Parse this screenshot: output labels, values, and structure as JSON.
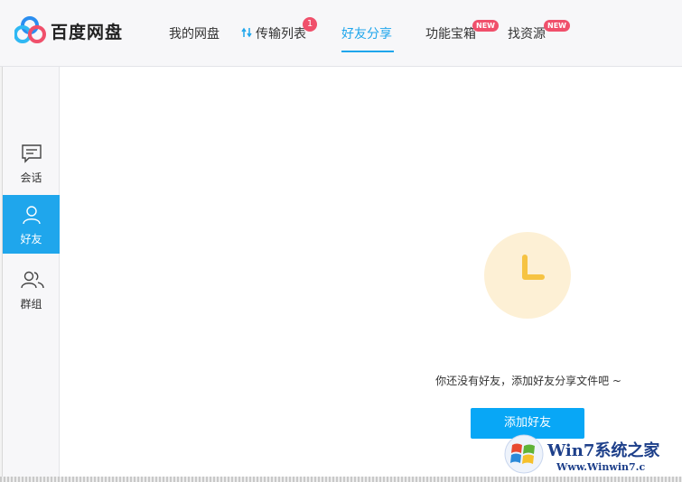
{
  "app": {
    "logo_text": "百度网盘"
  },
  "nav": {
    "items": [
      {
        "label": "我的网盘"
      },
      {
        "label": "传输列表",
        "badge": "1"
      },
      {
        "label": "好友分享",
        "active": true
      },
      {
        "label": "功能宝箱",
        "badge": "NEW"
      },
      {
        "label": "找资源",
        "badge": "NEW"
      }
    ]
  },
  "sidebar": {
    "items": [
      {
        "label": "会话",
        "icon": "chat-icon"
      },
      {
        "label": "好友",
        "icon": "person-icon",
        "active": true
      },
      {
        "label": "群组",
        "icon": "group-icon"
      }
    ]
  },
  "main": {
    "empty_icon": "clock-icon",
    "empty_text": "你还没有好友，添加好友分享文件吧 ~",
    "add_button": "添加好友"
  },
  "watermark": {
    "title": "Win7系统之家",
    "url": "Www.Winwin7.c"
  },
  "colors": {
    "accent": "#1fa6ec",
    "badge": "#f0506b",
    "button": "#08a7f6",
    "icon_bg": "#fdf0d5",
    "icon_fg": "#f6c342"
  }
}
